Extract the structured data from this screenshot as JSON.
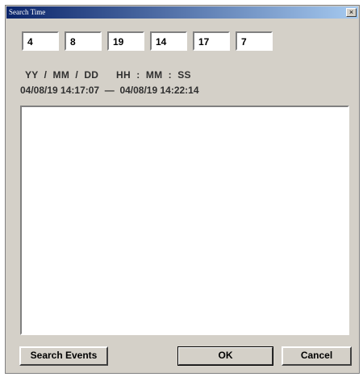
{
  "window": {
    "title": "Search Time",
    "close_glyph": "×"
  },
  "time_fields": [
    "4",
    "8",
    "19",
    "14",
    "17",
    "7"
  ],
  "format_label": "YY  /  MM  /  DD      HH  :  MM  :  SS",
  "range": {
    "start": "04/08/19 14:17:07",
    "separator": "—",
    "end": "04/08/19 14:22:14"
  },
  "buttons": {
    "search_events": "Search Events",
    "ok": "OK",
    "cancel": "Cancel"
  }
}
